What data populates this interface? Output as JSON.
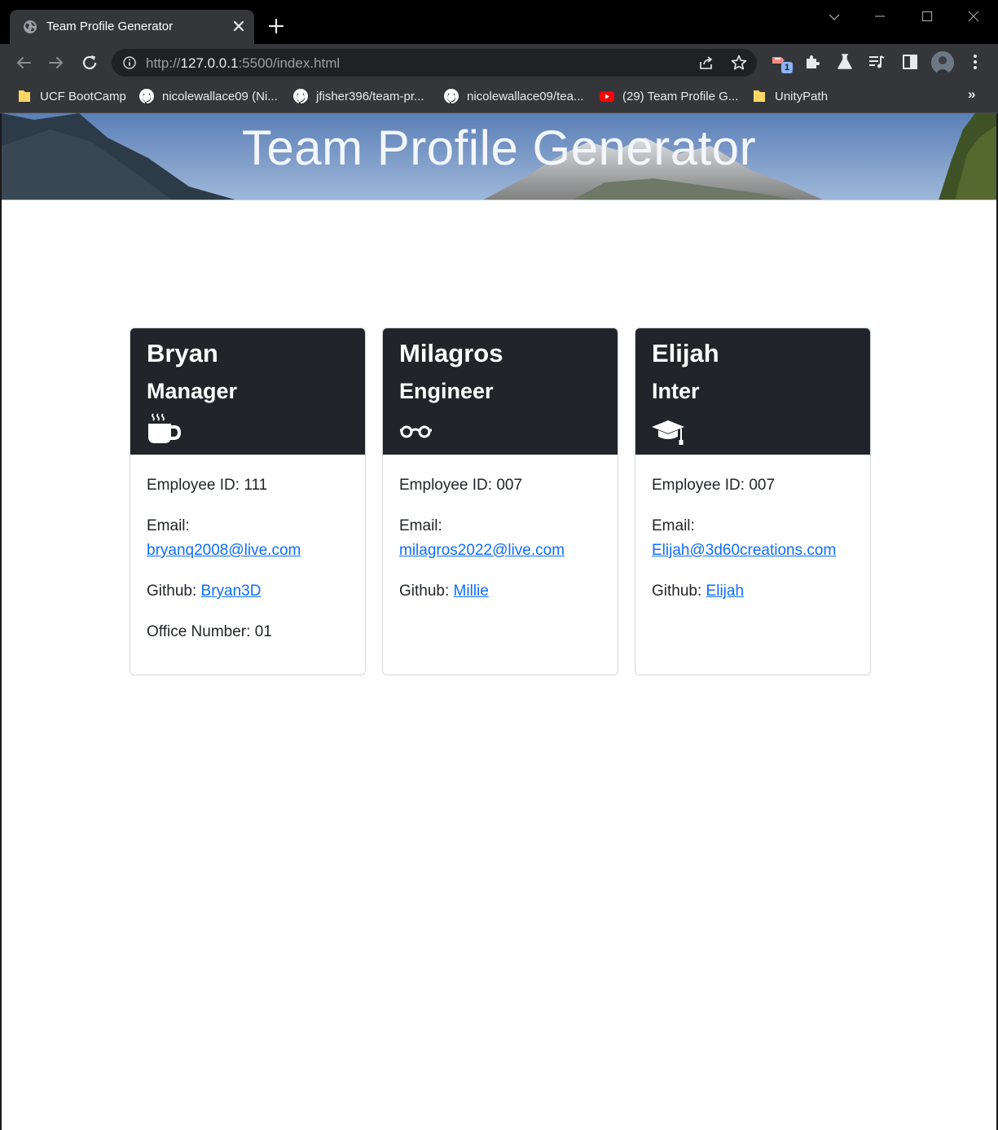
{
  "browser": {
    "tab_title": "Team Profile Generator",
    "url_scheme": "http://",
    "url_host": "127.0.0.1",
    "url_rest": ":5500/index.html",
    "extension_badge": "1",
    "bookmarks": [
      {
        "label": "UCF BootCamp",
        "icon": "folder-icon"
      },
      {
        "label": "nicolewallace09 (Ni...",
        "icon": "github-icon"
      },
      {
        "label": "jfisher396/team-pr...",
        "icon": "github-icon"
      },
      {
        "label": "nicolewallace09/tea...",
        "icon": "github-icon"
      },
      {
        "label": "(29) Team Profile G...",
        "icon": "youtube-icon"
      },
      {
        "label": "UnityPath",
        "icon": "folder-icon"
      }
    ],
    "bookmarks_more": "»"
  },
  "page": {
    "title": "Team Profile Generator"
  },
  "labels": {
    "employee_id": "Employee ID: ",
    "email": "Email:",
    "github": "Github: ",
    "office_number": "Office Number: "
  },
  "employees": [
    {
      "name": "Bryan",
      "role": "Manager",
      "icon": "coffee-mug-icon",
      "id": "111",
      "email": "bryanq2008@live.com",
      "github": "Bryan3D",
      "office_number": "01"
    },
    {
      "name": "Milagros",
      "role": "Engineer",
      "icon": "glasses-icon",
      "id": "007",
      "email": "milagros2022@live.com",
      "github": "Millie"
    },
    {
      "name": "Elijah",
      "role": "Inter",
      "icon": "graduation-cap-icon",
      "id": "007",
      "email": "Elijah@3d60creations.com",
      "github": "Elijah"
    }
  ],
  "colors": {
    "card_header": "#212529",
    "link": "#0d6efd",
    "chrome_dark": "#202124",
    "chrome_toolbar": "#35363a"
  }
}
